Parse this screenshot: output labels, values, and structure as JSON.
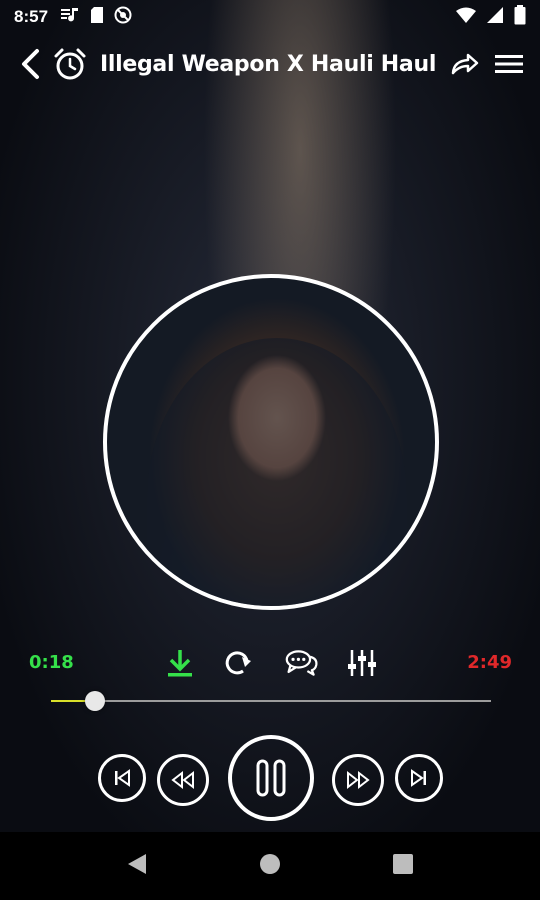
{
  "status_bar": {
    "time": "8:57",
    "icons": [
      "music-note-icon",
      "sd-card-icon",
      "no-entry-icon"
    ],
    "right_icons": [
      "wifi-icon",
      "signal-icon",
      "battery-icon"
    ]
  },
  "app_bar": {
    "title": "Illegal Weapon X Hauli Hauli - S",
    "back_icon": "back-arrow-icon",
    "alarm_icon": "alarm-clock-icon",
    "share_icon": "share-icon",
    "menu_icon": "menu-icon"
  },
  "player": {
    "elapsed": "0:18",
    "total": "2:49",
    "progress_fraction": 0.1,
    "elapsed_color": "#35e04a",
    "total_color": "#e0282a",
    "download_color": "#35e04a",
    "tool_icons": [
      "download-icon",
      "repeat-icon",
      "chat-icon",
      "equalizer-icon"
    ]
  },
  "transport": {
    "buttons": [
      "skip-previous",
      "rewind",
      "pause",
      "fast-forward",
      "skip-next"
    ]
  },
  "nav_bar": {
    "buttons": [
      "back",
      "home",
      "recents"
    ]
  }
}
